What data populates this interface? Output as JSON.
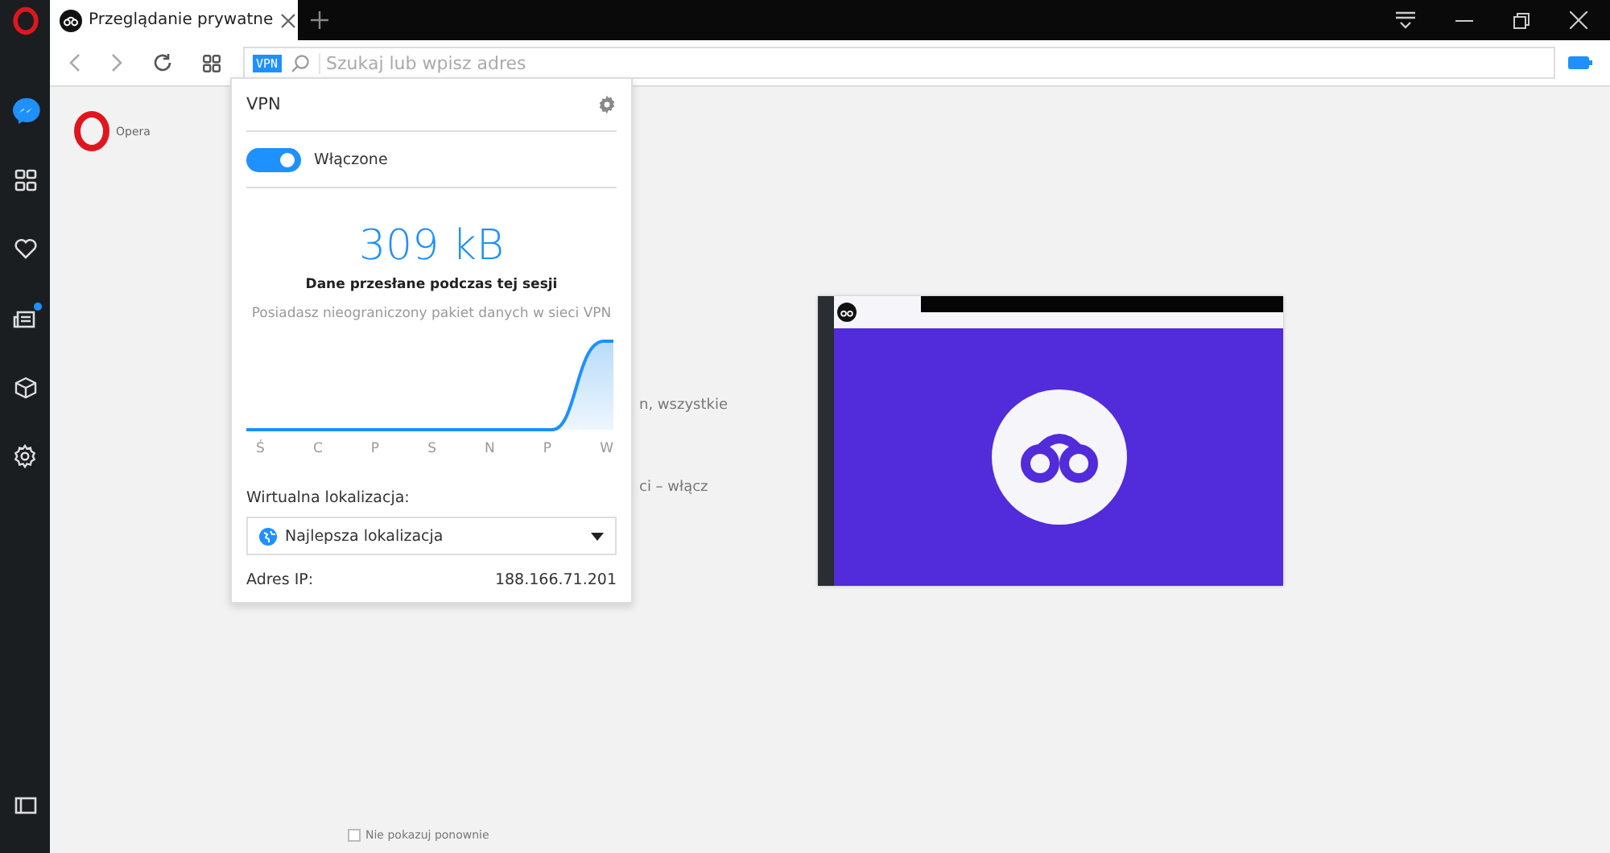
{
  "tabs": [
    {
      "title": "Przeglądanie prywatne",
      "selected": true
    }
  ],
  "address_bar": {
    "badge": "VPN",
    "placeholder": "Szukaj lub wpisz adres"
  },
  "sidebar": {
    "items": [
      {
        "kind": "messenger",
        "notification": false
      },
      {
        "kind": "speed-dial",
        "notification": false
      },
      {
        "kind": "heart",
        "notification": false
      },
      {
        "kind": "news",
        "notification": true
      },
      {
        "kind": "cube",
        "notification": false
      },
      {
        "kind": "settings",
        "notification": false
      }
    ]
  },
  "page": {
    "brand": "Opera",
    "fragments": [
      "n, wszystkie",
      "ci – włącz"
    ],
    "dont_show_again": {
      "label": "Nie pokazuj ponownie",
      "checked": false
    }
  },
  "vpn_popup": {
    "title": "VPN",
    "toggle": {
      "label": "Włączone",
      "on": true
    },
    "amount": "309 kB",
    "amount_caption": "Dane przesłane podczas tej sesji",
    "note": "Posiadasz nieograniczony pakiet danych w sieci VPN",
    "days": [
      "Ś",
      "C",
      "P",
      "S",
      "N",
      "P",
      "W"
    ],
    "location_label": "Wirtualna lokalizacja:",
    "location": "Najlepsza lokalizacja",
    "ip_label": "Adres IP:",
    "ip": "188.166.71.201"
  }
}
